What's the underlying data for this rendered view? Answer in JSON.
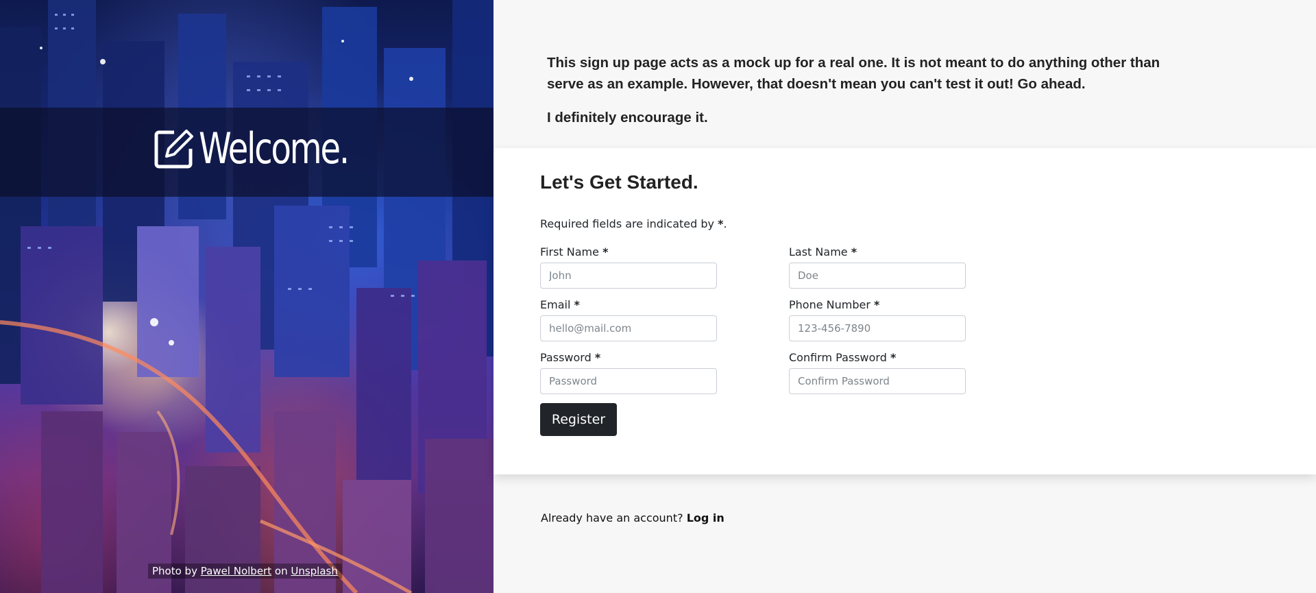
{
  "hero": {
    "welcome_text": "Welcome.",
    "credit": {
      "prefix": "Photo by",
      "photographer": "Pawel Nolbert",
      "middle": "on",
      "source": "Unsplash"
    }
  },
  "intro": {
    "paragraph1": "This sign up page acts as a mock up for a real one. It is not meant to do anything other than serve as an example. However, that doesn't mean you can't test it out! Go ahead.",
    "paragraph2": "I definitely encourage it."
  },
  "form": {
    "title": "Let's Get Started.",
    "required_note_prefix": "Required fields are indicated by",
    "required_marker": "*",
    "required_note_suffix": ".",
    "fields": {
      "first_name": {
        "label": "First Name",
        "placeholder": "John",
        "value": ""
      },
      "last_name": {
        "label": "Last Name",
        "placeholder": "Doe",
        "value": ""
      },
      "email": {
        "label": "Email",
        "placeholder": "hello@mail.com",
        "value": ""
      },
      "phone": {
        "label": "Phone Number",
        "placeholder": "123-456-7890",
        "value": ""
      },
      "password": {
        "label": "Password",
        "placeholder": "Password",
        "value": ""
      },
      "confirm_password": {
        "label": "Confirm Password",
        "placeholder": "Confirm Password",
        "value": ""
      }
    },
    "submit_label": "Register"
  },
  "footer": {
    "login_prompt": "Already have an account?",
    "login_link": "Log in"
  },
  "colors": {
    "page_background": "#f7f7f7",
    "card_background": "#ffffff",
    "button_background": "#212529",
    "text": "#212529"
  },
  "icons": {
    "welcome_icon": "edit-square-icon"
  }
}
